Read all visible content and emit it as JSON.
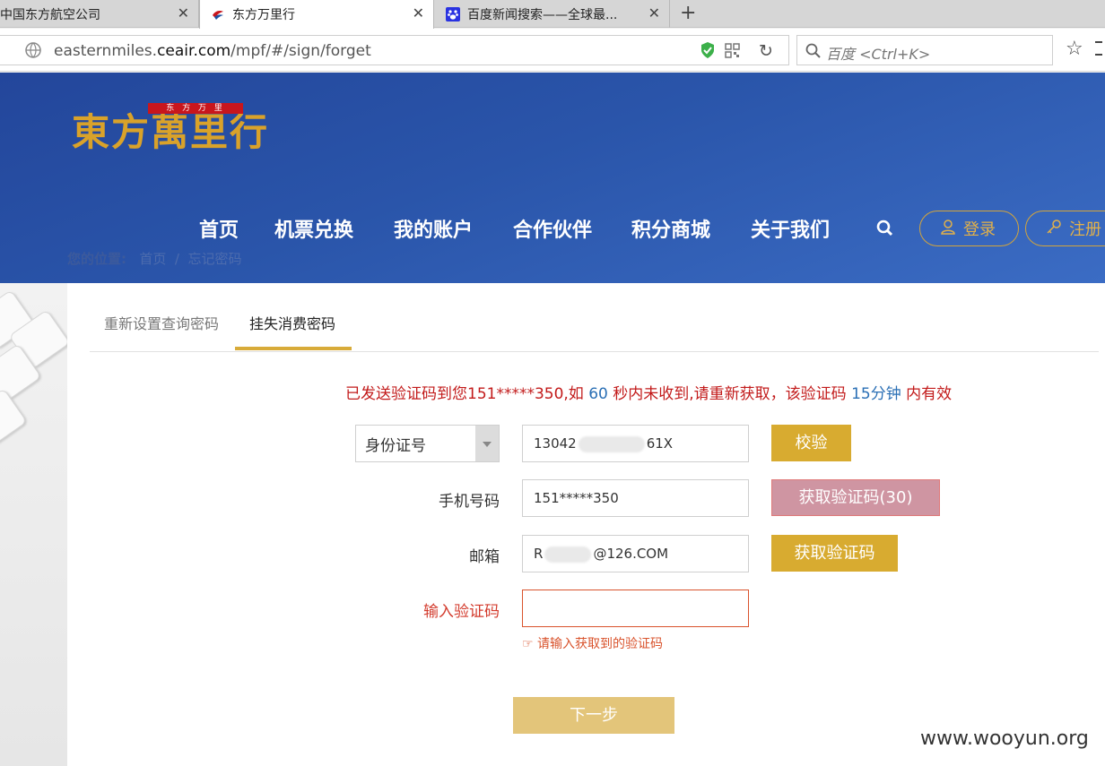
{
  "browser": {
    "tabs": [
      {
        "title": "中国东方航空公司",
        "active": false
      },
      {
        "title": "东方万里行",
        "active": true
      },
      {
        "title": "百度新闻搜索——全球最...",
        "active": false
      }
    ],
    "new_tab_label": "+",
    "close_glyph": "✕",
    "url_prefix": "easternmiles.",
    "url_domain": "ceair.com",
    "url_path": "/mpf/#/sign/forget",
    "search_placeholder": "百度 <Ctrl+K>"
  },
  "site": {
    "logo_red_text": "东 方 万 里",
    "logo_text": "東方萬里行",
    "nav": [
      "首页",
      "机票兑换",
      "我的账户",
      "合作伙伴",
      "积分商城",
      "关于我们"
    ],
    "login_label": "登录",
    "register_label": "注册",
    "breadcrumb": {
      "label": "您的位置:",
      "home": "首页",
      "sep": "/",
      "current": "忘记密码"
    }
  },
  "form": {
    "tabs": [
      "重新设置查询密码",
      "挂失消费密码"
    ],
    "active_tab": 1,
    "notice": {
      "prefix": "已发送验证码到您151*****350,如",
      "seconds": "60",
      "middle": "秒内未收到,请重新获取，该验证码",
      "minutes": "15分钟",
      "suffix": "内有效"
    },
    "id_type": "身份证号",
    "id_value_start": "13042",
    "id_value_end": "61X",
    "verify_label": "校验",
    "phone_label": "手机号码",
    "phone_value": "151*****350",
    "get_code_countdown_label": "获取验证码(30)",
    "email_label": "邮箱",
    "email_value_start": "R",
    "email_value_end": "@126.COM",
    "get_code_label": "获取验证码",
    "code_label": "输入验证码",
    "code_value": "",
    "code_hint": "请输入获取到的验证码",
    "next_label": "下一步"
  },
  "watermark": "www.wooyun.org",
  "colors": {
    "gold": "#d8ab30",
    "header_blue": "#2a55aa",
    "error_red": "#c21a1a",
    "number_blue": "#2a6fb5",
    "pink_button": "#cf95a2"
  }
}
